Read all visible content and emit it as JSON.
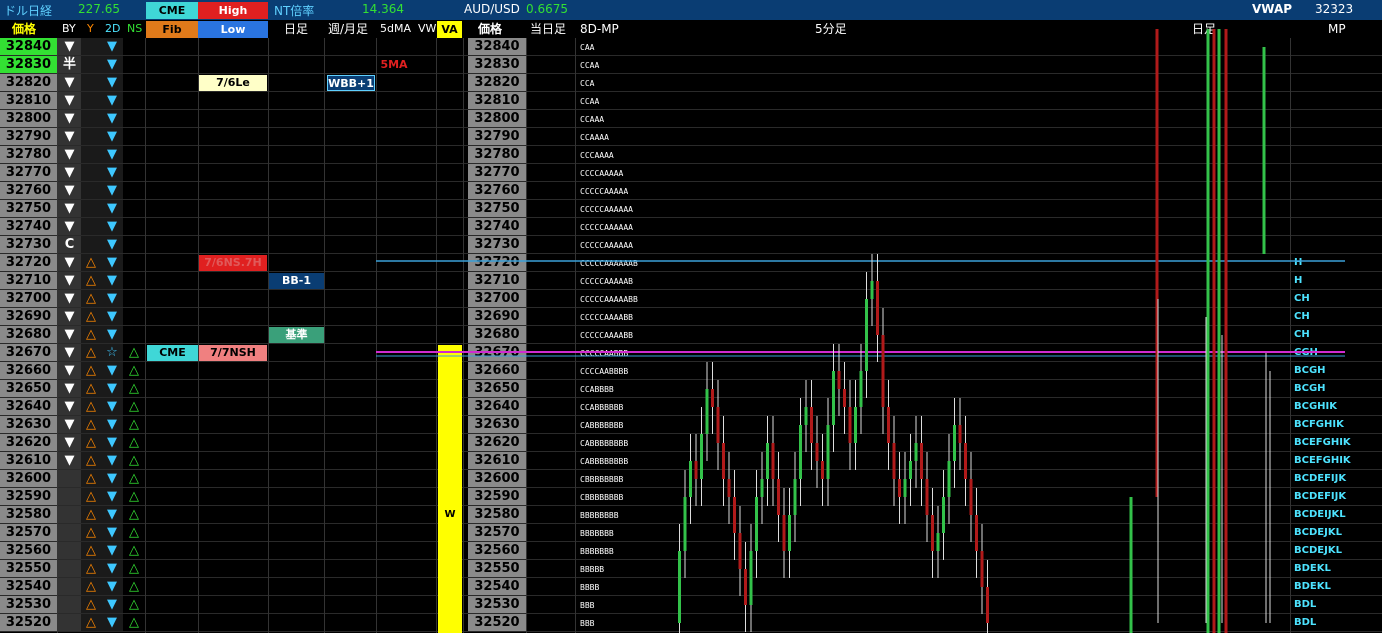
{
  "top": {
    "usdjpy_label": "ドル日経",
    "usdjpy_value": "227.65",
    "cme_label": "CME",
    "high_label": "High",
    "nt_label": "NT倍率",
    "nt_value": "14.364",
    "audusd_label": "AUD/USD",
    "audusd_value": "0.6675",
    "vwap_label": "VWAP",
    "vwap_value": "32323"
  },
  "header": {
    "price": "価格",
    "by": "BY",
    "y": "Y",
    "d2": "2D",
    "ns": "NS",
    "fib": "Fib",
    "low": "Low",
    "daily": "日足",
    "week_month": "週/月足",
    "ma5": "5dMA",
    "vw": "VW",
    "va": "VA",
    "price2": "価格",
    "today": "当日足",
    "mp8d": "8D-MP",
    "min5": "5分足",
    "daily2": "日足",
    "mp": "MP"
  },
  "prices": [
    "32840",
    "32830",
    "32820",
    "32810",
    "32800",
    "32790",
    "32780",
    "32770",
    "32760",
    "32750",
    "32740",
    "32730",
    "32720",
    "32710",
    "32700",
    "32690",
    "32680",
    "32670",
    "32660",
    "32650",
    "32640",
    "32630",
    "32620",
    "32610",
    "32600",
    "32590",
    "32580",
    "32570",
    "32560",
    "32550",
    "32540",
    "32530",
    "32520"
  ],
  "by_marks": [
    "▼",
    "半",
    "▼",
    "▼",
    "▼",
    "▼",
    "▼",
    "▼",
    "▼",
    "▼",
    "▼",
    "C",
    "▼",
    "▼",
    "▼",
    "▼",
    "▼",
    "▼",
    "▼",
    "▼",
    "▼",
    "▼",
    "▼",
    "▼",
    "",
    "",
    "",
    "",
    "",
    "",
    "",
    "",
    ""
  ],
  "y_marks": [
    "",
    "",
    "",
    "",
    "",
    "",
    "",
    "",
    "",
    "",
    "",
    "",
    "△",
    "△",
    "△",
    "△",
    "△",
    "△",
    "△",
    "△",
    "△",
    "△",
    "△",
    "△",
    "△",
    "△",
    "△",
    "△",
    "△",
    "△",
    "△",
    "△",
    "△"
  ],
  "d2_marks": [
    "▼",
    "▼",
    "▼",
    "▼",
    "▼",
    "▼",
    "▼",
    "▼",
    "▼",
    "▼",
    "▼",
    "▼",
    "▼",
    "▼",
    "▼",
    "▼",
    "▼",
    "☆",
    "▼",
    "▼",
    "▼",
    "▼",
    "▼",
    "▼",
    "▼",
    "▼",
    "▼",
    "▼",
    "▼",
    "▼",
    "▼",
    "▼",
    "▼"
  ],
  "ns_marks": [
    "",
    "",
    "",
    "",
    "",
    "",
    "",
    "",
    "",
    "",
    "",
    "",
    "",
    "",
    "",
    "",
    "",
    "△",
    "△",
    "△",
    "△",
    "△",
    "△",
    "△",
    "△",
    "△",
    "△",
    "△",
    "△",
    "△",
    "△",
    "△",
    "△"
  ],
  "labels": {
    "fib_7_6le": "7/6Le",
    "wbb1": "WBB+1",
    "ma5_tag": "5MA",
    "fib_7_6ns": "7/6NS.7H",
    "bb_1": "BB-1",
    "kijun": "基準",
    "cme_tag": "CME",
    "fib_7_7nsh": "7/7NSH",
    "va_w": "W"
  },
  "mp8d": [
    "CAA",
    "CCAA",
    "CCA",
    "CCAA",
    "CCAAA",
    "CCAAAA",
    "CCCAAAA",
    "CCCCAAAAA",
    "CCCCCAAAAA",
    "CCCCCAAAAAA",
    "CCCCCAAAAAA",
    "CCCCCAAAAAA",
    "CCCCCAAAAAAB",
    "CCCCCAAAAAB",
    "CCCCCAAAAABB",
    "CCCCCAAAABB",
    "CCCCCAAAABB",
    "CCCCCAABBB",
    "CCCCAABBBB",
    "CCABBBB",
    "CCABBBBBB",
    "CABBBBBBB",
    "CABBBBBBBB",
    "CABBBBBBBB",
    "CBBBBBBBB",
    "CBBBBBBBB",
    "BBBBBBBB",
    "BBBBBBB",
    "BBBBBBB",
    "BBBBB",
    "BBBB",
    "BBB",
    "BBB"
  ],
  "mp_right": [
    "",
    "",
    "",
    "",
    "",
    "",
    "",
    "",
    "",
    "",
    "",
    "",
    "H",
    "H",
    "CH",
    "CH",
    "CH",
    "CGH",
    "BCGH",
    "BCGH",
    "BCGHIK",
    "BCFGHIK",
    "BCEFGHIK",
    "BCEFGHIK",
    "BCDEFIJK",
    "BCDEFIJK",
    "BCDEIJKL",
    "BCDEJKL",
    "BCDEJKL",
    "BDEKL",
    "BDEKL",
    "BDL",
    "BDL"
  ],
  "colors": {
    "topbar": "#0a3d73",
    "price_cell": "#8a8a8a",
    "green_highlight": "#33e033",
    "va_yellow": "#ffff00",
    "up_candle": "#33c24a",
    "down_candle": "#b01a1a",
    "mp_cyan": "#4de3ff",
    "hline_blue": "#3aa0d8",
    "hline_magenta": "#d02ad0"
  }
}
